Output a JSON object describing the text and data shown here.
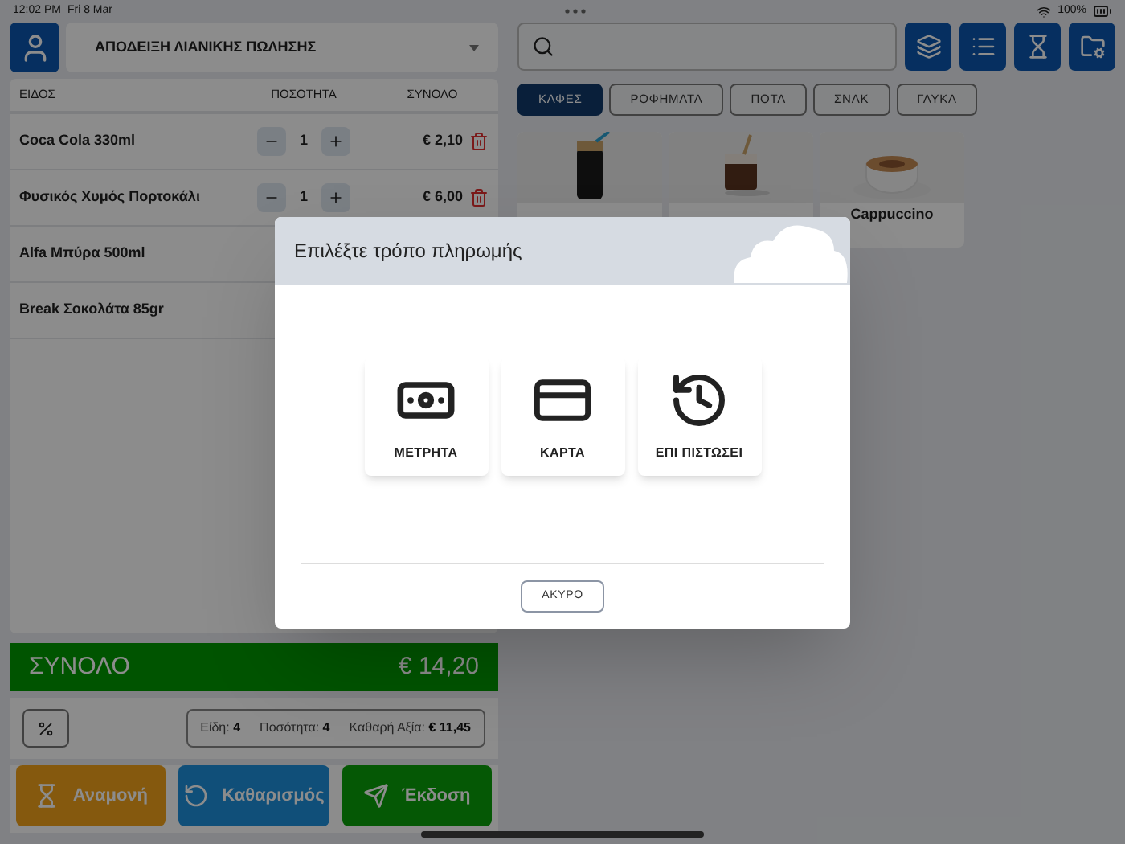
{
  "status_bar": {
    "time": "12:02 PM",
    "date": "Fri 8 Mar",
    "battery": "100%"
  },
  "document_type": {
    "value": "ΑΠΟΔΕΙΞΗ ΛΙΑΝΙΚΗΣ ΠΩΛΗΣΗΣ"
  },
  "table": {
    "columns": [
      "ΕΙΔΟΣ",
      "ΠΟΣΟΤΗΤΑ",
      "ΣΥΝΟΛΟ"
    ],
    "rows": [
      {
        "name": "Coca Cola 330ml",
        "quantity": "1",
        "total": "€ 2,10"
      },
      {
        "name": "Φυσικός Χυμός Πορτοκάλι",
        "quantity": "1",
        "total": "€ 6,00"
      },
      {
        "name": "Alfa Μπύρα 500ml"
      },
      {
        "name": "Break Σοκολάτα 85gr"
      }
    ]
  },
  "total": {
    "label": "ΣΥΝΟΛΟ",
    "amount": "€ 14,20"
  },
  "summary": [
    {
      "label": "Είδη:",
      "value": "4"
    },
    {
      "label": "Ποσότητα:",
      "value": "4"
    },
    {
      "label": "Καθαρή Αξία:",
      "value": "€ 11,45"
    }
  ],
  "actions": [
    {
      "label": "Αναμονή",
      "kind": "hold"
    },
    {
      "label": "Καθαρισμός",
      "kind": "clear"
    },
    {
      "label": "Έκδοση",
      "kind": "issue"
    }
  ],
  "categories": [
    {
      "label": "ΚΑΦΕΣ",
      "selected": true
    },
    {
      "label": "ΡΟΦΗΜΑΤΑ",
      "selected": false
    },
    {
      "label": "ΠΟΤΑ",
      "selected": false
    },
    {
      "label": "ΣΝΑΚ",
      "selected": false
    },
    {
      "label": "ΓΛΥΚΑ",
      "selected": false
    }
  ],
  "products": [
    {
      "kind": "picture"
    },
    {
      "kind": "picture"
    },
    {
      "kind": "picture",
      "name": "Cappuccino"
    }
  ],
  "dialog": {
    "title": "Επιλέξτε τρόπο πληρωμής",
    "options": [
      {
        "label": "ΜΕΤΡΗΤΑ",
        "kind": "cash"
      },
      {
        "label": "ΚΑΡΤΑ",
        "kind": "card"
      },
      {
        "label": "ΕΠΙ ΠΙΣΤΩΣΕΙ",
        "kind": "credit"
      }
    ],
    "cancel": "ΑΚΥΡΟ"
  }
}
